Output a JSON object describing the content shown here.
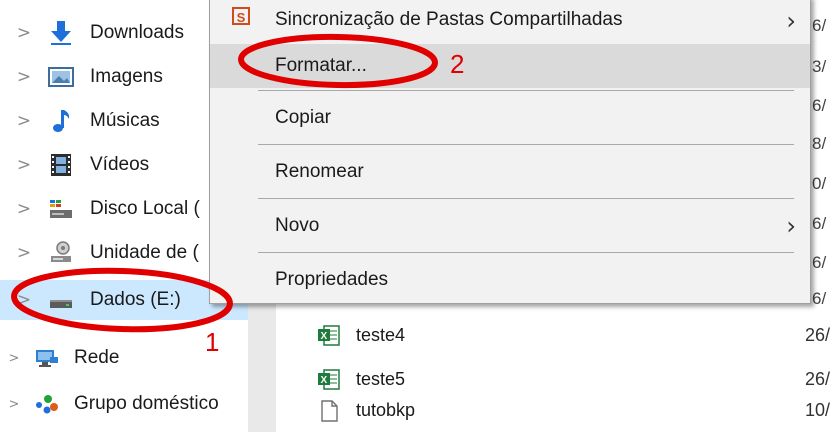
{
  "nav": {
    "items": [
      {
        "label": "Downloads",
        "icon": "download-arrow-icon"
      },
      {
        "label": "Imagens",
        "icon": "pictures-icon"
      },
      {
        "label": "Músicas",
        "icon": "music-note-icon"
      },
      {
        "label": "Vídeos",
        "icon": "film-icon"
      },
      {
        "label": "Disco Local (",
        "icon": "local-disk-icon"
      },
      {
        "label": "Unidade de (",
        "icon": "network-drive-icon"
      },
      {
        "label": "Dados (E:)",
        "icon": "drive-icon",
        "selected": true
      },
      {
        "label": "Rede",
        "icon": "network-icon"
      },
      {
        "label": "Grupo doméstico",
        "icon": "homegroup-icon"
      }
    ]
  },
  "files": [
    {
      "name": "teste4",
      "date": "26/",
      "icon": "excel-file-icon"
    },
    {
      "name": "teste5",
      "date": "26/",
      "icon": "excel-file-icon"
    },
    {
      "name": "tutobkp",
      "date": "10/",
      "icon": "blank-file-icon"
    }
  ],
  "date_column_fragments": [
    "6/",
    "3/",
    "6/",
    "8/",
    "0/",
    "6/",
    "6/",
    "6/"
  ],
  "context_menu": {
    "items": [
      {
        "label": "Sincronização de Pastas Compartilhadas",
        "submenu": true,
        "icon": "sync-share-icon"
      },
      {
        "label": "Formatar...",
        "hover": true
      },
      {
        "label": "Copiar"
      },
      {
        "label": "Renomear"
      },
      {
        "label": "Novo",
        "submenu": true
      },
      {
        "label": "Propriedades"
      }
    ]
  },
  "annotations": {
    "step1": "1",
    "step2": "2",
    "color": "#e00000"
  },
  "colors": {
    "selection": "#cce8ff",
    "menu_bg": "#f2f2f2",
    "menu_hover": "#dadada"
  }
}
